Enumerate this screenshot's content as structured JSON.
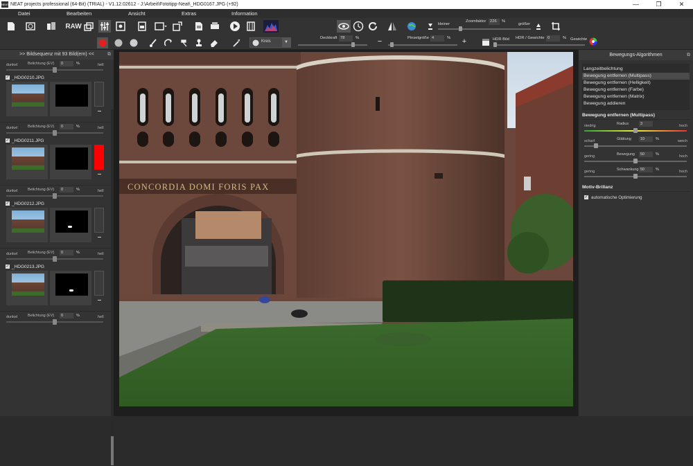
{
  "window": {
    "title": "NEAT projects professional (64-Bit) (TRIAL) - V1.12.02612 - J:\\Arbeit\\Fototipp-Neat\\_HDG0167.JPG (+92)",
    "app_icon_text": "NEAT"
  },
  "menu": [
    "Datei",
    "Bearbeiten",
    "Ansicht",
    "Extras",
    "Information"
  ],
  "toolbar1": {
    "raw_label": "RAW",
    "zoom_smaller": "kleiner",
    "zoom_label": "Zoomfaktor",
    "zoom_value": "226",
    "zoom_unit": "%",
    "zoom_larger": "größer"
  },
  "toolbar2": {
    "brush_shape": "Kreis",
    "opacity_label": "Deckkraft",
    "opacity_value": "78",
    "opacity_unit": "%",
    "brush_size_label": "Pinselgröße",
    "brush_size_value": "4",
    "brush_size_unit": "%",
    "minus": "−",
    "plus": "+",
    "hdr_label": "HDR Bild",
    "hdr_weight_label": "HDR / Gewichte",
    "hdr_weight_value": "0",
    "hdr_weight_unit": "%",
    "weights_label": "Gewichte"
  },
  "left_panel": {
    "title": ">> Bildsequenz mit 93 Bild(ern) <<",
    "exposure": {
      "dark": "dunkel",
      "label": "Belichtung (EV)",
      "value": "0",
      "unit": "%",
      "bright": "hell"
    },
    "frames": [
      {
        "name": "_HDG0210.JPG",
        "flag": false
      },
      {
        "name": "_HDG0211.JPG",
        "flag": true
      },
      {
        "name": "_HDG0212.JPG",
        "flag": false
      },
      {
        "name": "_HDG0213.JPG",
        "flag": false
      }
    ]
  },
  "image": {
    "inscription": "CONCORDIA DOMI FORIS PAX"
  },
  "right_panel": {
    "title": "Bewegungs-Algorithmen",
    "algorithms": [
      "Langzeitbelichtung",
      "Bewegung entfernen (Multipass)",
      "Bewegung entfernen (Helligkeit)",
      "Bewegung entfernen (Farbe)",
      "Bewegung entfernen (Matrix)",
      "Bewegung addieren"
    ],
    "selected_index": 1,
    "section_title": "Bewegung entfernen (Multipass)",
    "params": [
      {
        "low": "niedrig",
        "name": "Radius",
        "value": "3",
        "unit": "",
        "high": "hoch",
        "level": 0.5
      },
      {
        "low": "scharf",
        "name": "Glättung",
        "value": "10",
        "unit": "%",
        "high": "weich",
        "level": 0.1
      },
      {
        "low": "gering",
        "name": "Bewegung",
        "value": "50",
        "unit": "%",
        "high": "hoch",
        "level": 0.5
      },
      {
        "low": "gering",
        "name": "Schwankung",
        "value": "50",
        "unit": "%",
        "high": "hoch",
        "level": 0.5
      }
    ],
    "brilliance_title": "Motiv-Brillanz",
    "auto_optimize": "automatische Optimierung"
  }
}
